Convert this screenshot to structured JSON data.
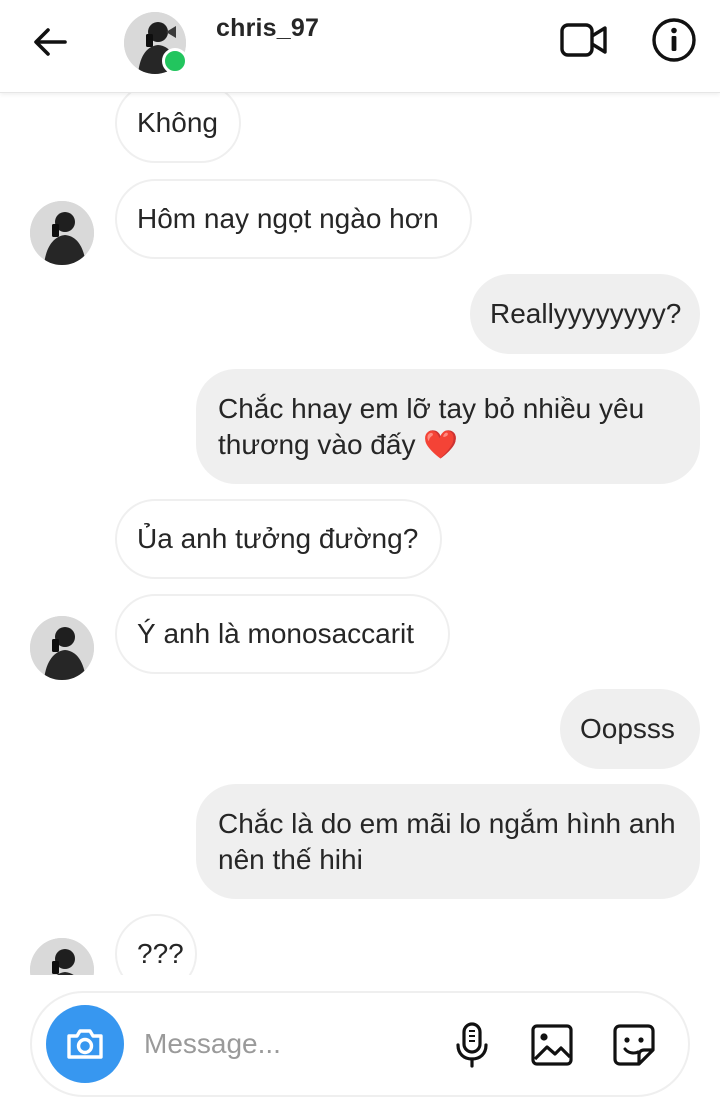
{
  "header": {
    "username": "chris_97",
    "online_color": "#22c55e",
    "back_icon": "arrow-left-icon",
    "video_icon": "video-camera-icon",
    "info_icon": "info-circle-icon"
  },
  "messages": [
    {
      "direction": "incoming",
      "text": "Không",
      "show_avatar": false
    },
    {
      "direction": "incoming",
      "text": "Hôm nay ngọt ngào hơn",
      "show_avatar": true
    },
    {
      "direction": "outgoing",
      "text": "Reallyyyyyyyy?"
    },
    {
      "direction": "outgoing",
      "text": "Chắc hnay em lỡ tay bỏ nhiều yêu thương vào đấy ❤️"
    },
    {
      "direction": "incoming",
      "text": "Ủa anh tưởng đường?",
      "show_avatar": false
    },
    {
      "direction": "incoming",
      "text": "Ý anh là monosaccarit",
      "show_avatar": true
    },
    {
      "direction": "outgoing",
      "text": "Oopsss"
    },
    {
      "direction": "outgoing",
      "text": "Chắc là do em mãi lo ngắm hình anh nên thế hihi"
    },
    {
      "direction": "incoming",
      "text": "???",
      "show_avatar": true
    }
  ],
  "composer": {
    "placeholder": "Message...",
    "camera_icon": "camera-icon",
    "mic_icon": "microphone-icon",
    "gallery_icon": "image-icon",
    "sticker_icon": "sticker-icon",
    "accent_color": "#3797f0"
  }
}
